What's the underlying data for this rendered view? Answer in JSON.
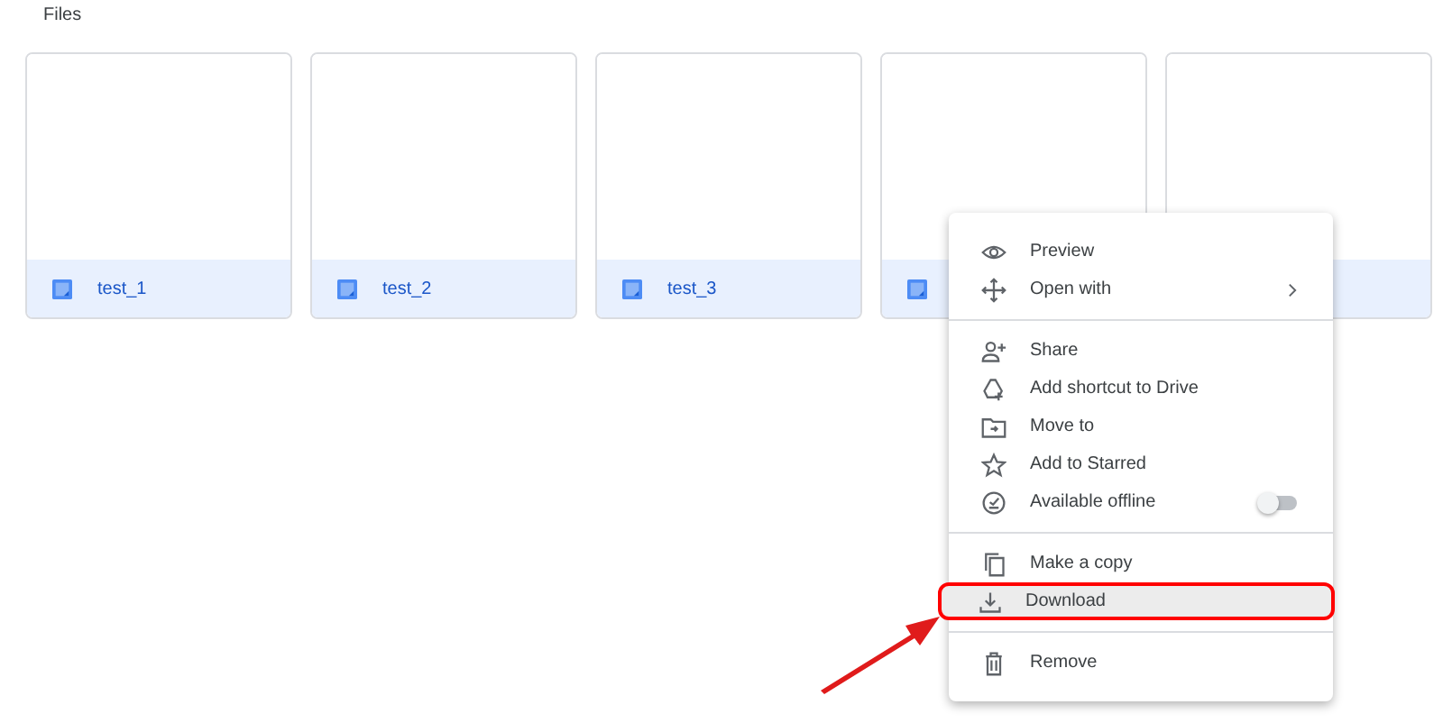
{
  "section_title": "Files",
  "files": [
    {
      "kind": "named",
      "name": "test_1"
    },
    {
      "kind": "named",
      "name": "test_2"
    },
    {
      "kind": "named",
      "name": "test_3"
    },
    {
      "kind": "icon_only"
    },
    {
      "kind": "covered"
    }
  ],
  "context_menu": {
    "groups": [
      [
        {
          "label": "Preview",
          "kind": "plain",
          "highlighted": false
        },
        {
          "label": "Open with",
          "kind": "submenu",
          "highlighted": false
        }
      ],
      [
        {
          "label": "Share",
          "kind": "plain",
          "highlighted": false
        },
        {
          "label": "Add shortcut to Drive",
          "kind": "plain",
          "highlighted": false
        },
        {
          "label": "Move to",
          "kind": "plain",
          "highlighted": false
        },
        {
          "label": "Add to Starred",
          "kind": "plain",
          "highlighted": false
        },
        {
          "label": "Available offline",
          "kind": "toggle",
          "on": false,
          "highlighted": false
        }
      ],
      [
        {
          "label": "Make a copy",
          "kind": "plain",
          "highlighted": false
        },
        {
          "label": "Download",
          "kind": "plain",
          "highlighted": true
        }
      ],
      [
        {
          "label": "Remove",
          "kind": "plain",
          "highlighted": false
        }
      ]
    ]
  }
}
